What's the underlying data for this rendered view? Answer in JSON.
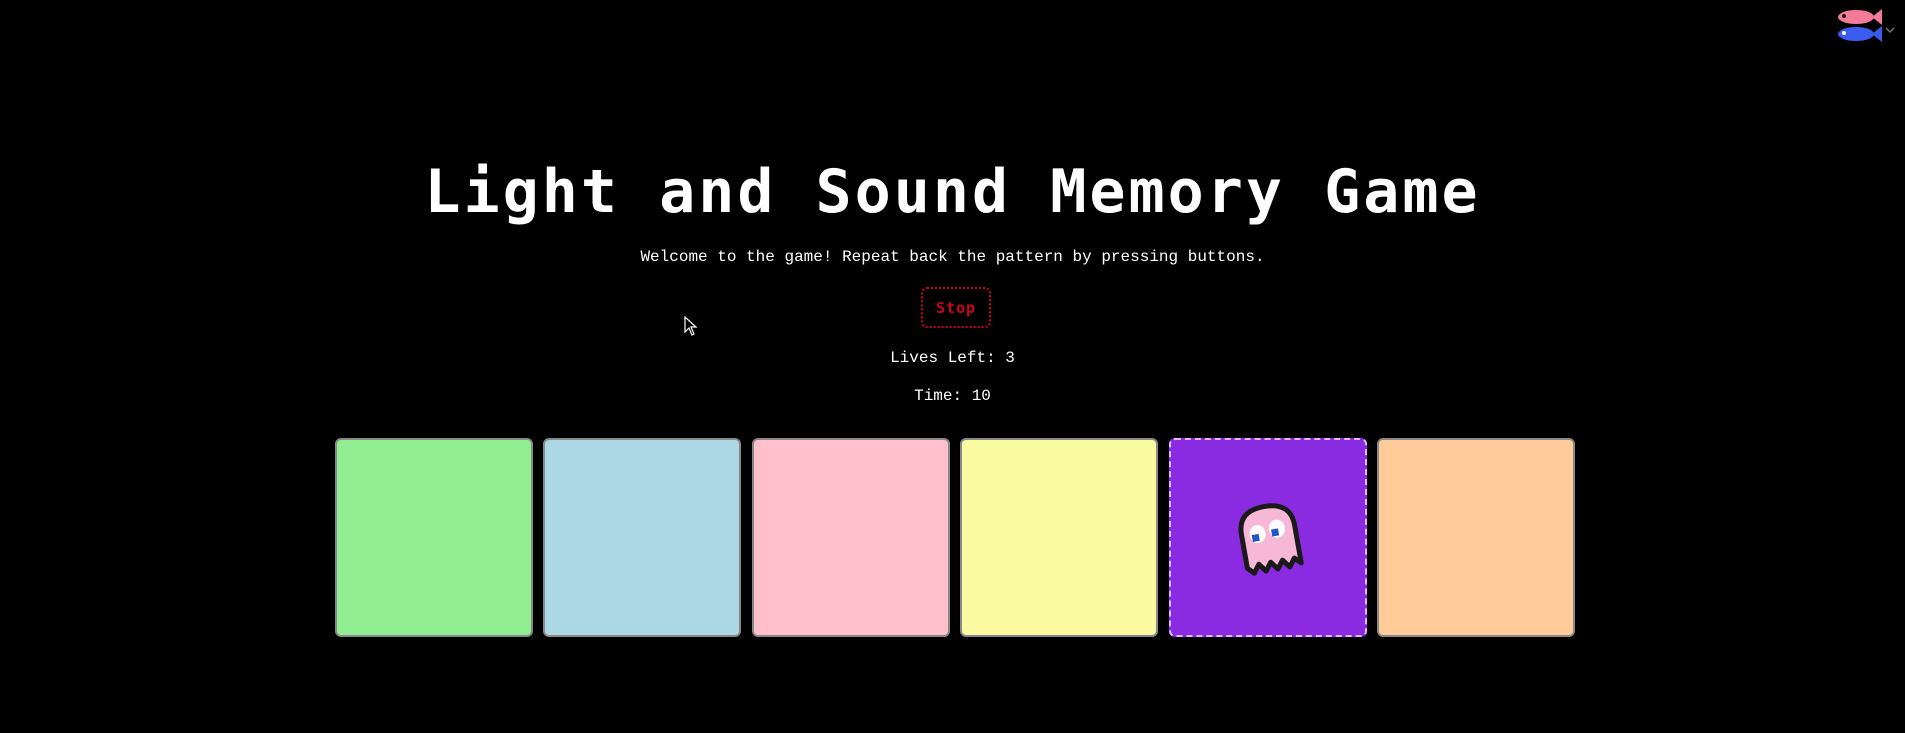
{
  "game": {
    "title": "Light and Sound Memory Game",
    "welcome": "Welcome to the game! Repeat back the pattern by pressing buttons.",
    "stop_label": "Stop",
    "lives_text": "Lives Left: 3",
    "time_text": "Time: 10"
  },
  "buttons": [
    {
      "color": "#90ee90",
      "active": false
    },
    {
      "color": "#add8e6",
      "active": false
    },
    {
      "color": "#ffc0cb",
      "active": false
    },
    {
      "color": "#fafaa0",
      "active": false
    },
    {
      "color": "#8a2be2",
      "active": true,
      "icon": "pink-ghost-icon"
    },
    {
      "color": "#ffcc99",
      "active": false
    }
  ],
  "colors": {
    "background": "#000000",
    "stop_accent": "#d0021b"
  },
  "icons": {
    "top_right": "fish-extension-icon"
  }
}
